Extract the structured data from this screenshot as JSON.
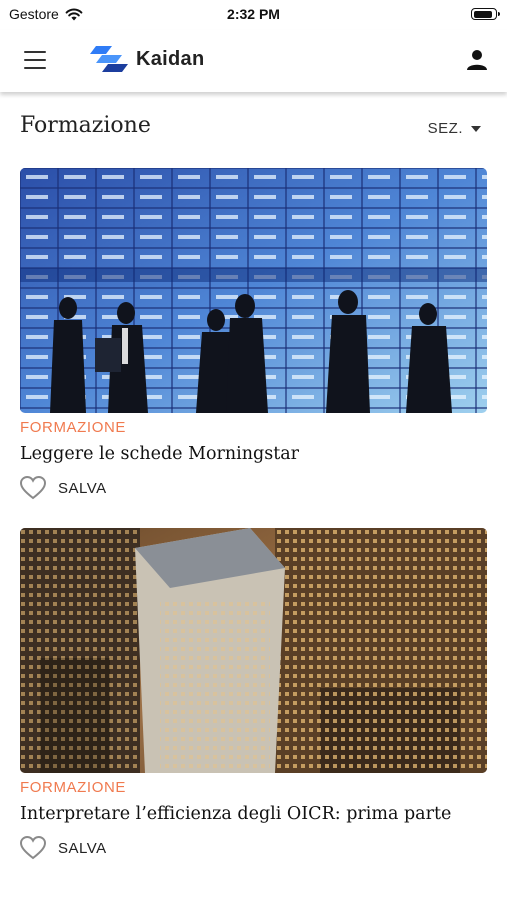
{
  "status_bar": {
    "carrier": "Gestore",
    "time": "2:32 PM",
    "battery_level": 0.9
  },
  "app_bar": {
    "brand": "Kaidan",
    "menu_icon": "hamburger-menu-icon",
    "account_icon": "user-icon"
  },
  "section": {
    "title": "Formazione",
    "filter_label": "SEZ."
  },
  "colors": {
    "category": "#F07A4F",
    "brand_blue": "#2F7CF6",
    "brand_dark": "#1C3E9E"
  },
  "articles": [
    {
      "category": "FORMAZIONE",
      "title": "Leggere le schede Morningstar",
      "save_label": "SALVA"
    },
    {
      "category": "FORMAZIONE",
      "title": "Interpretare l’efficienza degli OICR: prima parte",
      "save_label": "SALVA"
    }
  ]
}
